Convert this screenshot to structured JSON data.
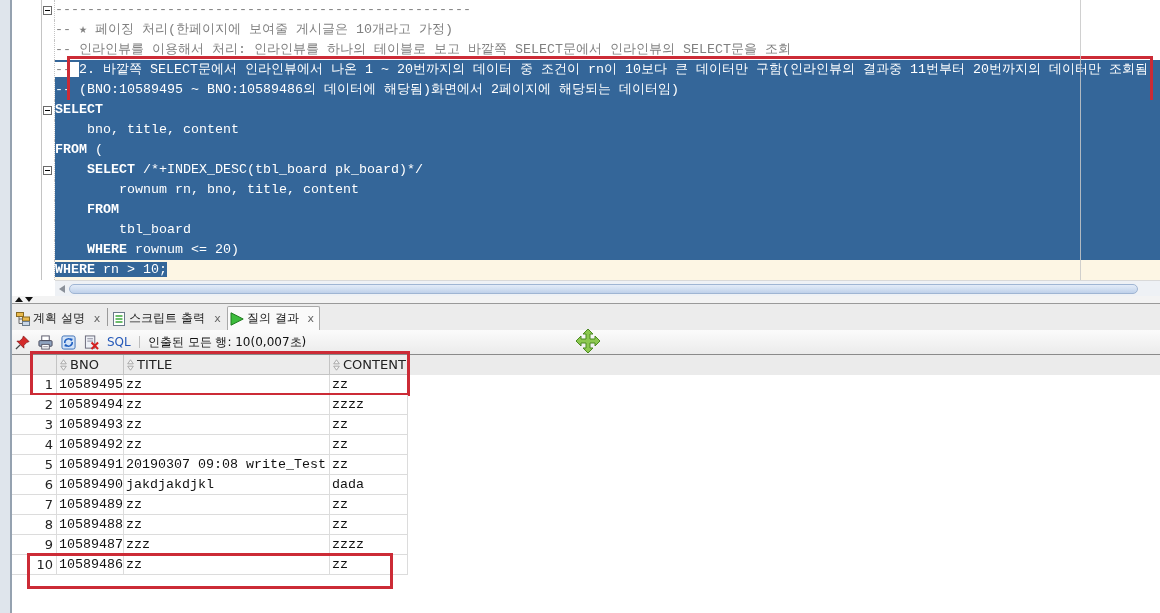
{
  "editor": {
    "lines": [
      {
        "fold": true,
        "selected": false,
        "current": false,
        "annotated": false,
        "tokens": [
          {
            "text": "----------------------------------------------------",
            "kind": "comment",
            "selected": false
          }
        ]
      },
      {
        "fold": false,
        "selected": false,
        "current": false,
        "annotated": false,
        "tokens": [
          {
            "text": "-- ★ 페이징 처리(한페이지에 보여줄 게시글은 10개라고 가정)",
            "kind": "comment",
            "selected": false
          }
        ]
      },
      {
        "fold": false,
        "selected": false,
        "current": false,
        "annotated": false,
        "tokens": [
          {
            "text": "-- 인라인뷰를 이용해서 처리: 인라인뷰를 하나의 테이블로 보고 바깥쪽 SELECT문에서 인라인뷰의 SELECT문을 조회",
            "kind": "comment",
            "selected": false
          }
        ]
      },
      {
        "fold": false,
        "selected": true,
        "current": false,
        "annotated": true,
        "tokens": [
          {
            "text": "-- ",
            "kind": "comment",
            "selected": false
          },
          {
            "text": "2. 바깥쪽 SELECT문에서 인라인뷰에서 나온 1 ~ 20번까지의 데이터 중 조건이 rn이 10보다 큰 데이터만 구함(인라인뷰의 결과중 11번부터 20번까지의 데이터만 조회됨",
            "kind": "comment",
            "selected": true
          }
        ]
      },
      {
        "fold": false,
        "selected": true,
        "current": false,
        "annotated": true,
        "tokens": [
          {
            "text": "-- (BNO:10589495 ~ BNO:10589486의 데이터에 해당됨)화면에서 2페이지에 해당되는 데이터임)",
            "kind": "comment",
            "selected": true
          }
        ]
      },
      {
        "fold": true,
        "selected": true,
        "current": false,
        "annotated": false,
        "tokens": [
          {
            "text": "SELECT",
            "kind": "keyword",
            "selected": true
          }
        ]
      },
      {
        "fold": false,
        "selected": true,
        "current": false,
        "annotated": false,
        "tokens": [
          {
            "text": "    bno, title, content",
            "kind": "code",
            "selected": true
          }
        ]
      },
      {
        "fold": false,
        "selected": true,
        "current": false,
        "annotated": false,
        "tokens": [
          {
            "text": "FROM",
            "kind": "keyword",
            "selected": true
          },
          {
            "text": " (",
            "kind": "code",
            "selected": true
          }
        ]
      },
      {
        "fold": true,
        "selected": true,
        "current": false,
        "annotated": false,
        "tokens": [
          {
            "text": "    SELECT",
            "kind": "keyword",
            "selected": true
          },
          {
            "text": " /*+INDEX_DESC(tbl_board pk_board)*/",
            "kind": "code",
            "selected": true
          }
        ]
      },
      {
        "fold": false,
        "selected": true,
        "current": false,
        "annotated": false,
        "tokens": [
          {
            "text": "        rownum rn, bno, title, content",
            "kind": "code",
            "selected": true
          }
        ]
      },
      {
        "fold": false,
        "selected": true,
        "current": false,
        "annotated": false,
        "tokens": [
          {
            "text": "    FROM",
            "kind": "keyword",
            "selected": true
          }
        ]
      },
      {
        "fold": false,
        "selected": true,
        "current": false,
        "annotated": false,
        "tokens": [
          {
            "text": "        tbl_board",
            "kind": "code",
            "selected": true
          }
        ]
      },
      {
        "fold": false,
        "selected": true,
        "current": false,
        "annotated": false,
        "tokens": [
          {
            "text": "    WHERE",
            "kind": "keyword",
            "selected": true
          },
          {
            "text": " rownum <= 20)",
            "kind": "code",
            "selected": true
          }
        ]
      },
      {
        "fold": false,
        "selected": false,
        "current": true,
        "annotated": false,
        "tokens": [
          {
            "text": "WHERE",
            "kind": "keyword",
            "selected": true
          },
          {
            "text": " rn > 10;",
            "kind": "code",
            "selected": true
          }
        ]
      }
    ]
  },
  "result_tabs": [
    {
      "kind": "plan",
      "label": "계획 설명",
      "close": "x",
      "selected": false
    },
    {
      "kind": "script",
      "label": "스크립트 출력",
      "close": "x",
      "selected": false
    },
    {
      "kind": "result",
      "label": "질의 결과",
      "close": "x",
      "selected": true
    }
  ],
  "toolbar": {
    "link": "SQL",
    "status": "인출된 모든 행: 10(0,007초)"
  },
  "grid": {
    "header_annotated": true,
    "columns": [
      "BNO",
      "TITLE",
      "CONTENT"
    ],
    "rows": [
      {
        "number": "1",
        "cells": [
          "10589495",
          "zz",
          "zz"
        ],
        "annotated": true
      },
      {
        "number": "2",
        "cells": [
          "10589494",
          "zz",
          "zzzz"
        ],
        "annotated": false
      },
      {
        "number": "3",
        "cells": [
          "10589493",
          "zz",
          "zz"
        ],
        "annotated": false
      },
      {
        "number": "4",
        "cells": [
          "10589492",
          "zz",
          "zz"
        ],
        "annotated": false
      },
      {
        "number": "5",
        "cells": [
          "10589491",
          "20190307 09:08 write_Test",
          "zz"
        ],
        "annotated": false
      },
      {
        "number": "6",
        "cells": [
          "10589490",
          "jakdjakdjkl",
          "dada"
        ],
        "annotated": false
      },
      {
        "number": "7",
        "cells": [
          "10589489",
          "zz",
          "zz"
        ],
        "annotated": false
      },
      {
        "number": "8",
        "cells": [
          "10589488",
          "zz",
          "zz"
        ],
        "annotated": false
      },
      {
        "number": "9",
        "cells": [
          "10589487",
          "zzz",
          "zzzz"
        ],
        "annotated": false
      },
      {
        "number": "10",
        "cells": [
          "10589486",
          "zz",
          "zz"
        ],
        "annotated": true
      }
    ]
  }
}
